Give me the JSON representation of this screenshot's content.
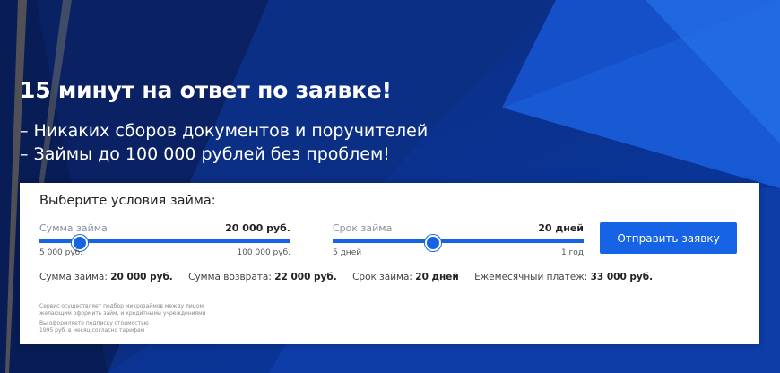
{
  "hero": {
    "title": "15 минут на ответ по заявке!",
    "line1": "– Никаких сборов документов и поручителей",
    "line2": "– Займы до 100 000 рублей без проблем!"
  },
  "form": {
    "title": "Выберите условия займа:",
    "amount_slider": {
      "label": "Сумма займа",
      "value": "20 000 руб.",
      "min": "5 000 руб.",
      "max": "100 000 руб.",
      "level": 0.16
    },
    "term_slider": {
      "label": "Срок займа",
      "value": "20 дней",
      "min": "5 дней",
      "max": "1 год",
      "level": 0.4
    },
    "submit_label": "Отправить заявку",
    "summary": {
      "amount_label": "Сумма займа:",
      "amount_value": "20 000 руб.",
      "return_label": "Сумма возврата:",
      "return_value": "22 000 руб.",
      "term_label": "Срок займа:",
      "term_value": "20 дней",
      "monthly_label": "Ежемесячный платеж:",
      "monthly_value": "33 000 руб."
    },
    "fine_print": {
      "p1_line1": "Сервис осуществляет подбор микрозаймов между лицом",
      "p1_line2": "желающим оформить займ, и кредитными учреждениями",
      "p2_line1": "Вы оформляете подписку стоимостью",
      "p2_line2": "1995 руб. в месяц согласно тарифам"
    }
  },
  "colors": {
    "accent": "#1763e6",
    "background_dark": "#0a2a78"
  }
}
